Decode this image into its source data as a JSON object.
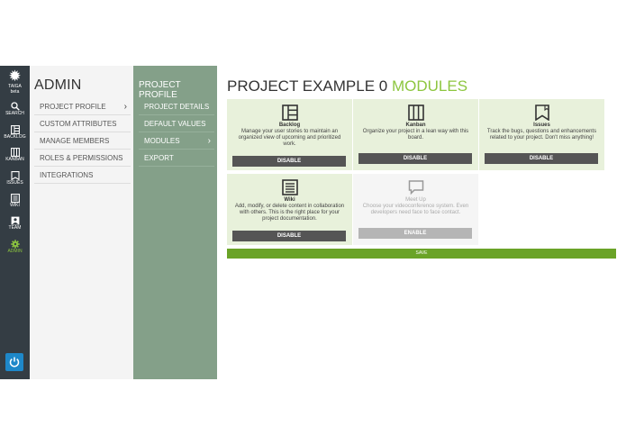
{
  "rail": {
    "logo_text": "TAIGA",
    "logo_sub": "beta",
    "items": [
      {
        "label": "SEARCH",
        "icon": "search-icon"
      },
      {
        "label": "BACKLOG",
        "icon": "backlog-icon"
      },
      {
        "label": "KANBAN",
        "icon": "kanban-icon"
      },
      {
        "label": "ISSUES",
        "icon": "issues-icon"
      },
      {
        "label": "WIKI",
        "icon": "wiki-icon"
      },
      {
        "label": "TEAM",
        "icon": "team-icon"
      },
      {
        "label": "ADMIN",
        "icon": "gear-icon"
      }
    ],
    "active_color": "#8dc63f"
  },
  "admin": {
    "title": "ADMIN",
    "items": [
      "PROJECT PROFILE",
      "CUSTOM ATTRIBUTES",
      "MANAGE MEMBERS",
      "ROLES & PERMISSIONS",
      "INTEGRATIONS"
    ]
  },
  "sub": {
    "title": "PROJECT PROFILE",
    "items": [
      "PROJECT DETAILS",
      "DEFAULT VALUES",
      "MODULES",
      "EXPORT"
    ]
  },
  "main": {
    "project_name": "PROJECT EXAMPLE 0",
    "section": "MODULES",
    "modules": [
      {
        "name": "Backlog",
        "icon": "backlog-icon",
        "description": "Manage your user stories to maintain an organized view of upcoming and prioritized work.",
        "button": "DISABLE",
        "enabled": true
      },
      {
        "name": "Kanban",
        "icon": "kanban-icon",
        "description": "Organize your project in a lean way with this board.",
        "button": "DISABLE",
        "enabled": true
      },
      {
        "name": "Issues",
        "icon": "issues-icon",
        "description": "Track the bugs, questions and enhancements related to your project. Don't miss anything!",
        "button": "DISABLE",
        "enabled": true
      },
      {
        "name": "Wiki",
        "icon": "wiki-icon",
        "description": "Add, modify, or delete content in collaboration with others. This is the right place for your project documentation.",
        "button": "DISABLE",
        "enabled": true
      },
      {
        "name": "Meet Up",
        "icon": "chat-icon",
        "description": "Choose your videoconference system. Even developers need face to face contact.",
        "button": "ENABLE",
        "enabled": false
      }
    ],
    "save_label": "SAVE"
  }
}
